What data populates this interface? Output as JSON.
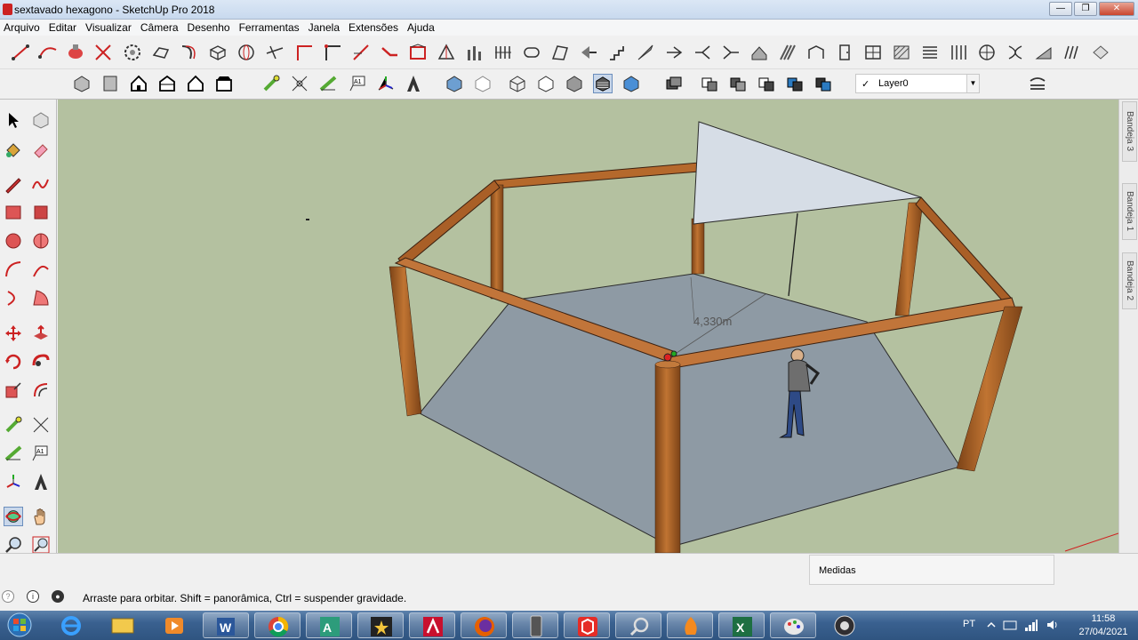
{
  "window": {
    "title": "sextavado hexagono - SketchUp Pro 2018",
    "controls": [
      "minimize",
      "maximize",
      "close"
    ]
  },
  "menu": [
    "Arquivo",
    "Editar",
    "Visualizar",
    "Câmera",
    "Desenho",
    "Ferramentas",
    "Janela",
    "Extensões",
    "Ajuda"
  ],
  "layer": {
    "checked": "✓",
    "name": "Layer0"
  },
  "trays": [
    "Bandeja 3",
    "Bandeja 1",
    "Bandeja 2"
  ],
  "viewport": {
    "dimension_label": "4,330m",
    "colors": {
      "sky": "#b4c1a0",
      "ground": "#8f9aa5",
      "wood": "#b0682c",
      "roof": "#d6dde6"
    }
  },
  "measurements": {
    "label": "Medidas"
  },
  "status": {
    "text": "Arraste para orbitar. Shift = panorâmica, Ctrl = suspender gravidade."
  },
  "taskbar": {
    "apps": [
      "internet-explorer",
      "file-explorer",
      "media-player",
      "word",
      "chrome",
      "app-a",
      "media",
      "autocad",
      "firefox",
      "phone",
      "sketchup",
      "search",
      "fire-app",
      "excel",
      "paint",
      "obs"
    ],
    "language": "PT",
    "time": "11:58",
    "date": "27/04/2021"
  }
}
